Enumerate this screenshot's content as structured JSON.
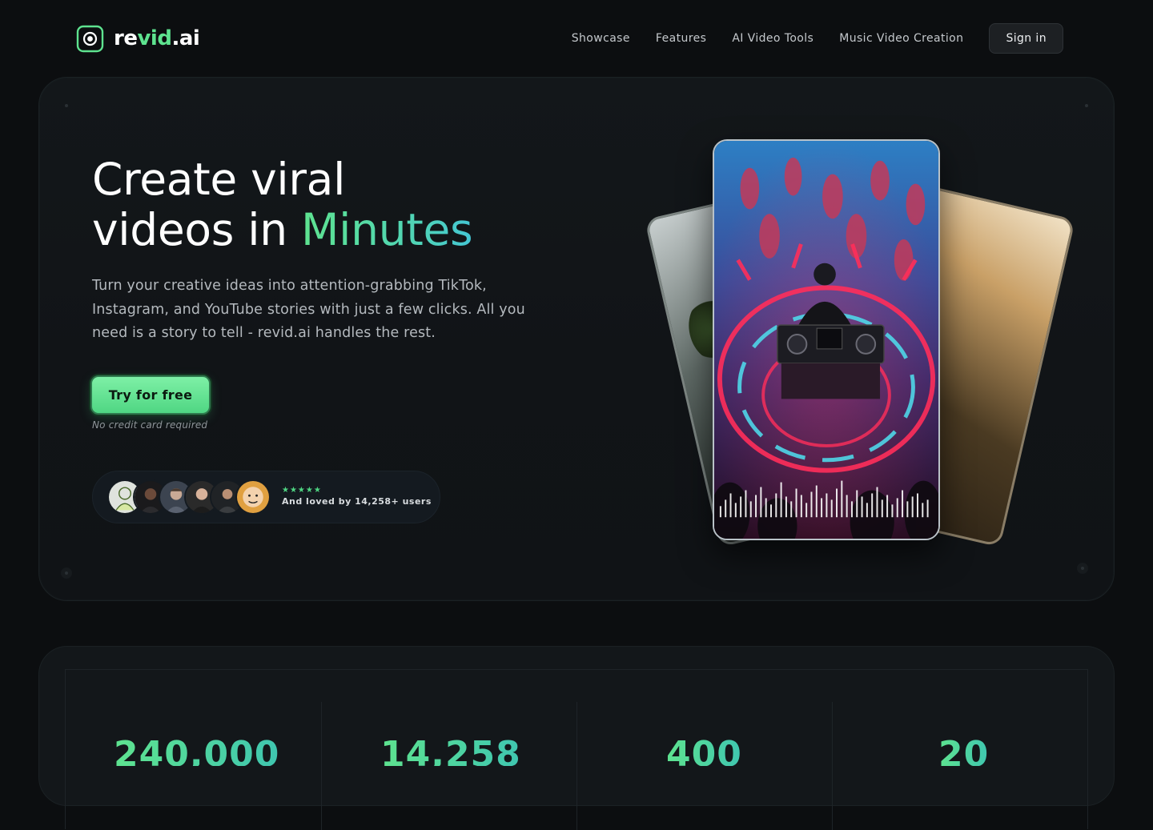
{
  "brand": {
    "name_part1": "re",
    "name_accent": "vid",
    "name_part2": ".ai"
  },
  "nav": {
    "links": [
      "Showcase",
      "Features",
      "AI Video Tools",
      "Music Video Creation"
    ],
    "signin_label": "Sign in"
  },
  "hero": {
    "headline_line1": "Create viral",
    "headline_line2_prefix": "videos in ",
    "headline_accent": "Minutes",
    "subtext": "Turn your creative ideas into attention-grabbing TikTok, Instagram, and YouTube stories with just a few clicks. All you need is a story to tell - revid.ai handles the rest.",
    "cta_label": "Try for free",
    "cta_note": "No credit card required",
    "rating_stars": "★★★★★",
    "social_proof": "And loved by 14,258+ users"
  },
  "stats": {
    "values": [
      "240,000",
      "14,258",
      "400",
      "20"
    ]
  },
  "colors": {
    "accent_green": "#5ee38f",
    "accent_teal": "#44c6d4",
    "background": "#0c0e10"
  }
}
